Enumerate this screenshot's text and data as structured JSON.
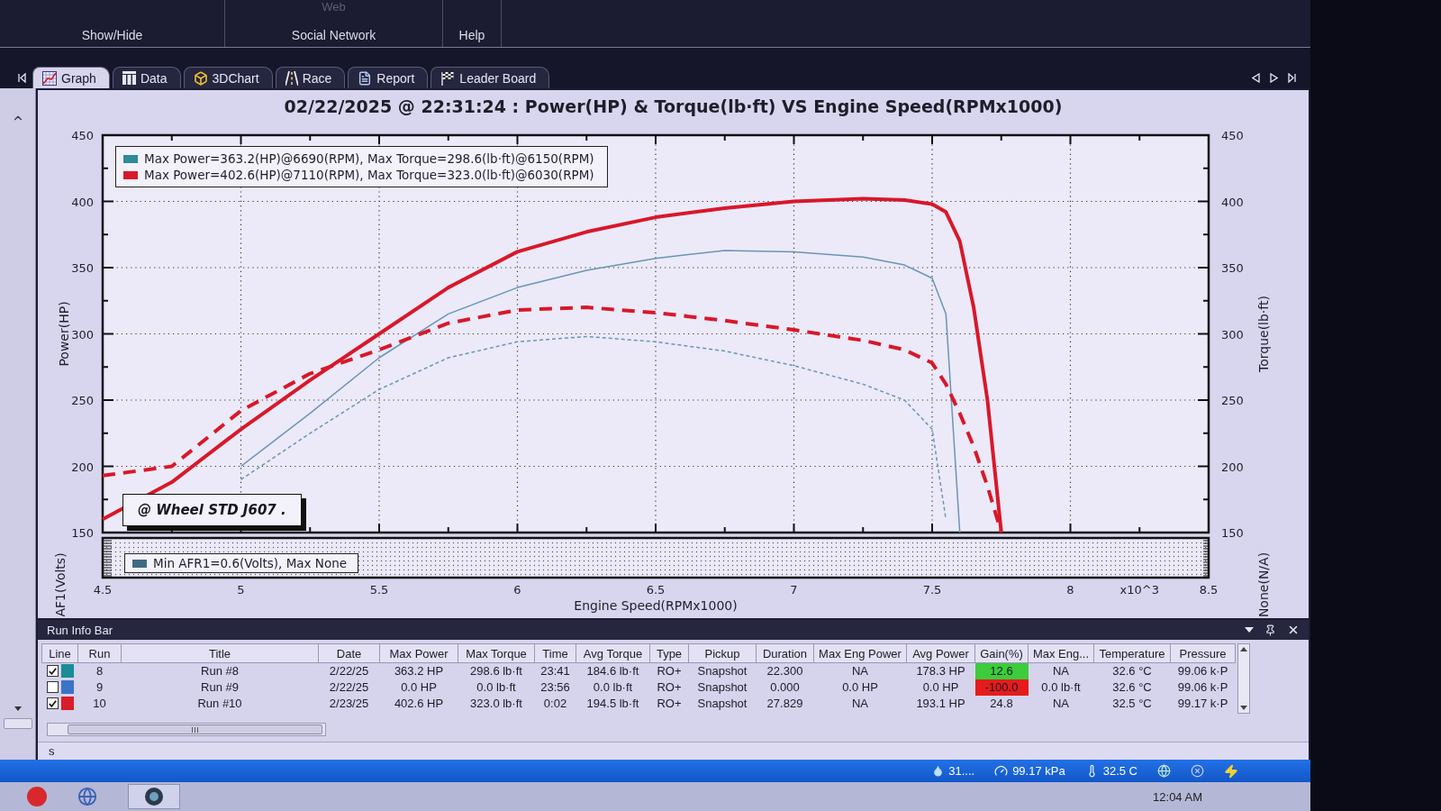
{
  "ribbon": {
    "groups": [
      {
        "label": "Show/Hide"
      },
      {
        "label": "Social Network",
        "items": [
          "Web"
        ]
      },
      {
        "label": "Help"
      }
    ]
  },
  "tabs": [
    {
      "label": "Graph",
      "selected": true
    },
    {
      "label": "Data",
      "selected": false
    },
    {
      "label": "3DChart",
      "selected": false
    },
    {
      "label": "Race",
      "selected": false
    },
    {
      "label": "Report",
      "selected": false
    },
    {
      "label": "Leader Board",
      "selected": false
    }
  ],
  "graph": {
    "chart_data": {
      "type": "line",
      "title": "02/22/2025 @ 22:31:24 : Power(HP) & Torque(lb·ft) VS Engine Speed(RPMx1000)",
      "xlabel": "Engine Speed(RPMx1000)",
      "ylabel": "Power(HP)",
      "x": [
        4.5,
        4.75,
        5,
        5.25,
        5.5,
        5.75,
        6,
        6.25,
        6.5,
        6.75,
        7,
        7.25,
        7.4,
        7.5,
        7.55,
        7.6,
        7.65,
        7.7,
        7.75
      ],
      "series": [
        {
          "color": "#6a94b8",
          "line_style": "solid",
          "values": [
            null,
            null,
            200,
            240,
            282,
            315,
            335,
            348,
            357,
            363,
            362,
            358,
            352,
            342,
            315,
            150,
            null,
            null,
            null
          ]
        },
        {
          "color": "#6a94b8",
          "line_style": "dashed",
          "values": [
            null,
            null,
            190,
            225,
            258,
            282,
            294,
            298,
            294,
            287,
            276,
            262,
            250,
            228,
            160,
            null,
            null,
            null,
            null
          ]
        },
        {
          "color": "#d8182a",
          "line_style": "solid",
          "values": [
            160,
            188,
            228,
            265,
            300,
            335,
            362,
            377,
            388,
            395,
            400,
            402,
            401,
            398,
            392,
            370,
            320,
            250,
            150
          ]
        },
        {
          "color": "#d8182a",
          "line_style": "dashed",
          "values": [
            193,
            200,
            242,
            270,
            288,
            308,
            318,
            320,
            316,
            310,
            303,
            295,
            288,
            278,
            262,
            240,
            215,
            185,
            150
          ]
        }
      ],
      "xlim": [
        4.5,
        8.5
      ],
      "ylim": [
        150,
        450
      ],
      "xticks": [
        4.5,
        5,
        5.5,
        6,
        6.5,
        7,
        7.5,
        8,
        8.5
      ],
      "yticks": [
        150,
        200,
        250,
        300,
        350,
        400,
        450
      ],
      "grid": true
    },
    "legend": [
      {
        "text": "Max Power=363.2(HP)@6690(RPM), Max Torque=298.6(lb·ft)@6150(RPM)",
        "color": "#2f8a9a"
      },
      {
        "text": "Max Power=402.6(HP)@7110(RPM), Max Torque=323.0(lb·ft)@6030(RPM)",
        "color": "#d8182a"
      }
    ],
    "annotation": "@ Wheel STD J607 .",
    "x_multiplier": "x10^3",
    "right_axis": {
      "label": "Torque(lb·ft)",
      "ticks": [
        "450",
        "400",
        "350",
        "300",
        "250",
        "200",
        "150"
      ]
    },
    "afr_strip": {
      "ylabel": "AF1(Volts)",
      "right_label": "None(N/A)",
      "legend": {
        "text": "Min AFR1=0.6(Volts), Max None",
        "color": "#3f6a82"
      }
    }
  },
  "run_info_bar": {
    "title": "Run Info Bar",
    "columns": [
      "Line",
      "Run",
      "Title",
      "Date",
      "Max Power",
      "Max Torque",
      "Time",
      "Avg Torque",
      "Type",
      "Pickup",
      "Duration",
      "Max Eng Power",
      "Avg Power",
      "Gain(%)",
      "Max Eng...",
      "Temperature",
      "Pressure"
    ],
    "rows": [
      {
        "cells": [
          {
            "checked": true,
            "color": "#1a8c96"
          },
          "8",
          "Run #8",
          "2/22/25",
          "363.2 HP",
          "298.6 lb·ft",
          "23:41",
          "184.6 lb·ft",
          "RO+",
          "Snapshot",
          "22.300",
          "NA",
          "178.3 HP",
          {
            "text": "12.6",
            "color": "#3ccc3c"
          },
          "NA",
          "32.6 °C",
          "99.06 k·P"
        ]
      },
      {
        "cells": [
          {
            "checked": false,
            "color": "#3a74c6"
          },
          "9",
          "Run #9",
          "2/22/25",
          "0.0 HP",
          "0.0 lb·ft",
          "23:56",
          "0.0 lb·ft",
          "RO+",
          "Snapshot",
          "0.000",
          "0.0 HP",
          "0.0 HP",
          {
            "text": "-100.0",
            "color": "#e41c1c"
          },
          "0.0 lb·ft",
          "32.6 °C",
          "99.06 k·P"
        ]
      },
      {
        "cells": [
          {
            "checked": true,
            "color": "#d81e28"
          },
          "10",
          "Run #10",
          "2/23/25",
          "402.6 HP",
          "323.0 lb·ft",
          "0:02",
          "194.5 lb·ft",
          "RO+",
          "Snapshot",
          "27.829",
          "NA",
          "193.1 HP",
          "24.8",
          "NA",
          "32.5 °C",
          "99.17 k·P"
        ]
      }
    ],
    "footer_text": "s"
  },
  "status_bar": {
    "items": [
      {
        "kind": "humidity",
        "text": "31...."
      },
      {
        "kind": "pressure",
        "text": "99.17 kPa"
      },
      {
        "kind": "temperature",
        "text": "32.5 C"
      }
    ]
  },
  "taskbar": {
    "clock": "12:04 AM"
  }
}
